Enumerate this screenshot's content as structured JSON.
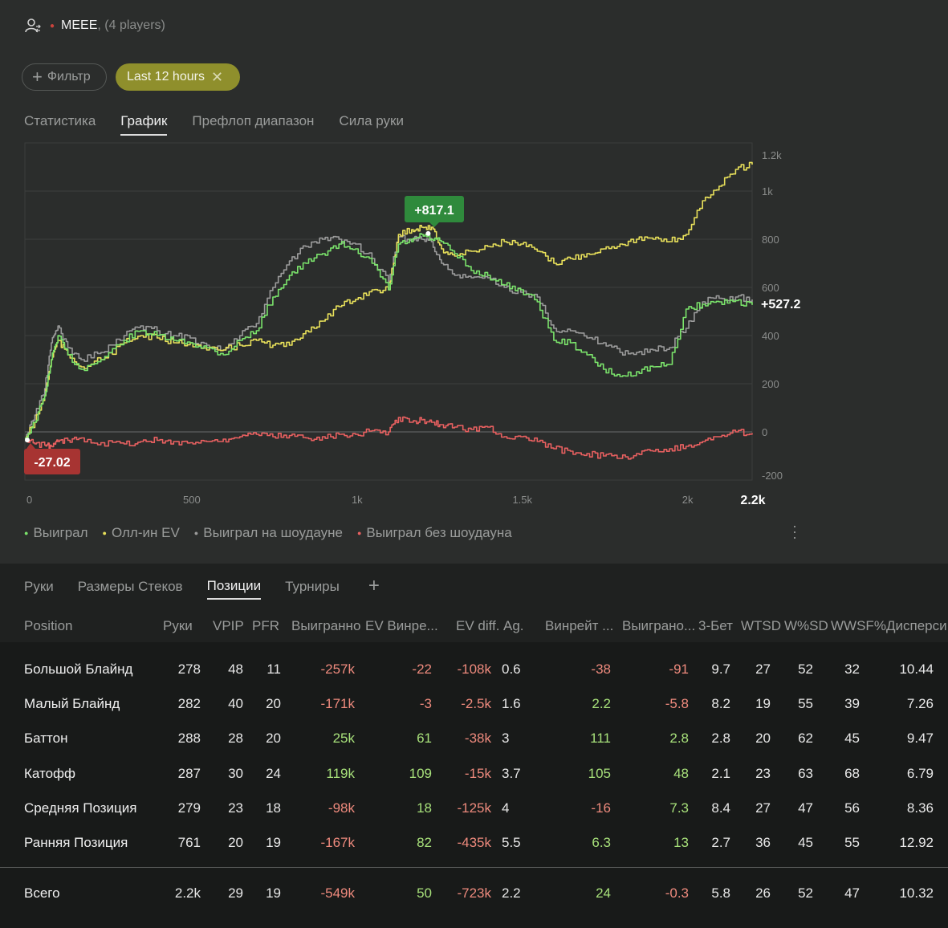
{
  "header": {
    "player": "MEEE",
    "player_count": ", (4 players)"
  },
  "filters": {
    "filter_label": "Фильтр",
    "time_label": "Last 12 hours"
  },
  "top_tabs": [
    "Статистика",
    "График",
    "Префлоп диапазон",
    "Сила руки"
  ],
  "active_top_tab": "График",
  "chart_data": {
    "type": "line",
    "x_ticks": [
      "0",
      "500",
      "1k",
      "1.5k",
      "2k"
    ],
    "x_max_label": "2.2k",
    "xlim": [
      0,
      2200
    ],
    "y_ticks": [
      "1.2k",
      "1k",
      "800",
      "600",
      "400",
      "200",
      "0",
      "-200"
    ],
    "ylim": [
      -200,
      1200
    ],
    "grid": true,
    "tooltip_high": "+817.1",
    "tooltip_low": "-27.02",
    "end_label": "+527.2",
    "series": [
      {
        "name": "Выиграл",
        "color": "#7be36b",
        "x": [
          0,
          30,
          60,
          80,
          100,
          130,
          170,
          230,
          300,
          350,
          400,
          450,
          500,
          550,
          600,
          650,
          700,
          750,
          800,
          850,
          900,
          950,
          1000,
          1050,
          1100,
          1130,
          1170,
          1200,
          1230,
          1260,
          1300,
          1350,
          1400,
          1450,
          1500,
          1550,
          1600,
          1650,
          1700,
          1750,
          1800,
          1850,
          1900,
          1950,
          2000,
          2050,
          2100,
          2150,
          2200
        ],
        "y": [
          -27,
          40,
          150,
          300,
          400,
          320,
          260,
          300,
          380,
          420,
          400,
          380,
          370,
          350,
          320,
          380,
          420,
          560,
          650,
          700,
          740,
          780,
          760,
          700,
          590,
          780,
          790,
          820,
          800,
          790,
          740,
          670,
          650,
          610,
          590,
          540,
          380,
          370,
          320,
          260,
          230,
          250,
          270,
          280,
          510,
          530,
          540,
          545,
          527
        ]
      },
      {
        "name": "Олл-ин EV",
        "color": "#e8e05a",
        "x": [
          0,
          30,
          60,
          80,
          100,
          130,
          170,
          230,
          300,
          350,
          400,
          450,
          500,
          550,
          600,
          650,
          700,
          750,
          800,
          850,
          900,
          950,
          1000,
          1050,
          1100,
          1130,
          1170,
          1200,
          1230,
          1260,
          1300,
          1350,
          1400,
          1450,
          1500,
          1550,
          1600,
          1650,
          1700,
          1750,
          1800,
          1850,
          1900,
          1950,
          2000,
          2050,
          2100,
          2150,
          2200
        ],
        "y": [
          -27,
          40,
          150,
          300,
          380,
          320,
          270,
          300,
          370,
          400,
          390,
          370,
          370,
          340,
          340,
          360,
          380,
          360,
          360,
          420,
          460,
          520,
          550,
          590,
          590,
          820,
          840,
          850,
          850,
          760,
          730,
          750,
          770,
          790,
          780,
          750,
          700,
          720,
          740,
          760,
          780,
          800,
          800,
          790,
          820,
          960,
          1020,
          1090,
          1110
        ]
      },
      {
        "name": "Выиграл на шоудауне",
        "color": "#9b9b9b",
        "x": [
          0,
          30,
          60,
          80,
          100,
          130,
          170,
          230,
          300,
          350,
          400,
          450,
          500,
          550,
          600,
          650,
          700,
          750,
          800,
          850,
          900,
          950,
          1000,
          1050,
          1100,
          1130,
          1170,
          1200,
          1230,
          1260,
          1300,
          1350,
          1400,
          1450,
          1500,
          1550,
          1600,
          1650,
          1700,
          1750,
          1800,
          1850,
          1900,
          1950,
          2000,
          2050,
          2100,
          2150,
          2200
        ],
        "y": [
          -27,
          70,
          180,
          370,
          440,
          350,
          300,
          330,
          400,
          440,
          420,
          400,
          390,
          360,
          340,
          400,
          450,
          600,
          710,
          770,
          800,
          800,
          780,
          720,
          620,
          810,
          800,
          800,
          790,
          700,
          650,
          640,
          640,
          600,
          580,
          560,
          430,
          420,
          390,
          370,
          330,
          330,
          340,
          350,
          430,
          540,
          555,
          560,
          550
        ]
      },
      {
        "name": "Выиграл без шоудауна",
        "color": "#e86060",
        "x": [
          0,
          30,
          60,
          80,
          100,
          130,
          170,
          230,
          300,
          350,
          400,
          450,
          500,
          550,
          600,
          650,
          700,
          750,
          800,
          850,
          900,
          950,
          1000,
          1050,
          1100,
          1130,
          1170,
          1200,
          1230,
          1260,
          1300,
          1350,
          1400,
          1450,
          1500,
          1550,
          1600,
          1650,
          1700,
          1750,
          1800,
          1850,
          1900,
          1950,
          2000,
          2050,
          2100,
          2150,
          2200
        ],
        "y": [
          -27,
          -50,
          -55,
          -60,
          -40,
          -35,
          -25,
          -45,
          -50,
          -40,
          -35,
          -40,
          -45,
          -40,
          -30,
          -20,
          -10,
          -20,
          -15,
          -25,
          -20,
          -10,
          -10,
          5,
          0,
          60,
          40,
          50,
          40,
          30,
          20,
          10,
          20,
          -20,
          -20,
          -40,
          -70,
          -80,
          -90,
          -100,
          -110,
          -90,
          -80,
          -70,
          -60,
          -40,
          -20,
          0,
          -5
        ]
      }
    ]
  },
  "legend": [
    "Выиграл",
    "Олл-ин EV",
    "Выиграл на шоудауне",
    "Выиграл без шоудауна"
  ],
  "bottom_tabs": [
    "Руки",
    "Размеры Стеков",
    "Позиции",
    "Турниры"
  ],
  "active_bottom_tab": "Позиции",
  "table": {
    "columns": [
      "Position",
      "Руки",
      "VPIP",
      "PFR",
      "Выигранно",
      "EV Винре...",
      "EV diff.",
      "Ag.",
      "Винрейт ...",
      "Выиграно...",
      "3-Бет",
      "WTSD",
      "W%SD",
      "WWSF%",
      "Дисперси"
    ],
    "rows": [
      [
        "Большой Блайнд",
        "278",
        "48",
        "11",
        "-257k",
        "-22",
        "-108k",
        "0.6",
        "-38",
        "-91",
        "9.7",
        "27",
        "52",
        "32",
        "10.44"
      ],
      [
        "Малый Блайнд",
        "282",
        "40",
        "20",
        "-171k",
        "-3",
        "-2.5k",
        "1.6",
        "2.2",
        "-5.8",
        "8.2",
        "19",
        "55",
        "39",
        "7.26"
      ],
      [
        "Баттон",
        "288",
        "28",
        "20",
        "25k",
        "61",
        "-38k",
        "3",
        "111",
        "2.8",
        "2.8",
        "20",
        "62",
        "45",
        "9.47"
      ],
      [
        "Катофф",
        "287",
        "30",
        "24",
        "119k",
        "109",
        "-15k",
        "3.7",
        "105",
        "48",
        "2.1",
        "23",
        "63",
        "68",
        "6.79"
      ],
      [
        "Средняя Позиция",
        "279",
        "23",
        "18",
        "-98k",
        "18",
        "-125k",
        "4",
        "-16",
        "7.3",
        "8.4",
        "27",
        "47",
        "56",
        "8.36"
      ],
      [
        "Ранняя Позиция",
        "761",
        "20",
        "19",
        "-167k",
        "82",
        "-435k",
        "5.5",
        "6.3",
        "13",
        "2.7",
        "36",
        "45",
        "55",
        "12.92"
      ]
    ],
    "total": [
      "Всего",
      "2.2k",
      "29",
      "19",
      "-549k",
      "50",
      "-723k",
      "2.2",
      "24",
      "-0.3",
      "5.8",
      "26",
      "52",
      "47",
      "10.32"
    ]
  }
}
